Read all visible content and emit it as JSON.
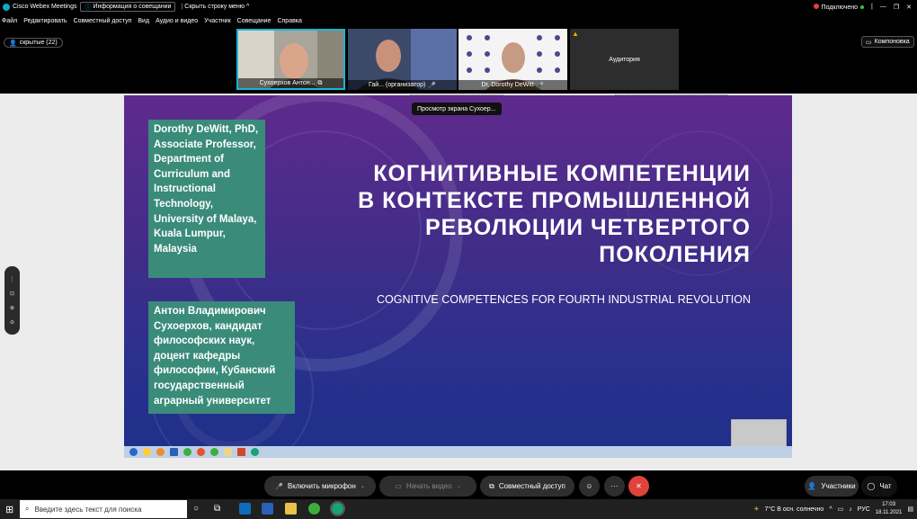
{
  "titlebar": {
    "app_name": "Cisco Webex Meetings",
    "info_button": "Информация о совещании",
    "hide_menu": "Скрыть строку меню",
    "status": "Подключено"
  },
  "menu": [
    "Файл",
    "Редактировать",
    "Совместный доступ",
    "Вид",
    "Аудио и видео",
    "Участник",
    "Совещание",
    "Справка"
  ],
  "strip": {
    "hidden_count_label": "скрытые (22)",
    "layout_label": "Компоновка",
    "tiles": [
      {
        "name": "Сухоерхов Антон..."
      },
      {
        "name": "Гай...  (организатор)"
      },
      {
        "name": "Dr. Dorothy DeWitt"
      },
      {
        "name": "Аудитория"
      }
    ]
  },
  "tooltip": "Просмотр экрана Сухоер...",
  "slide": {
    "author1": "Dorothy DeWitt, PhD, Associate Professor, Department of Curriculum and Instructional Technology, University of Malaya, Kuala Lumpur, Malaysia",
    "author2": "Антон Владимирович Сухоерхов, кандидат философских наук, доцент кафедры философии, Кубанский государственный аграрный университет",
    "title_lines": [
      "КОГНИТИВНЫЕ КОМПЕТЕНЦИИ",
      "В КОНТЕКСТЕ ПРОМЫШЛЕННОЙ",
      "РЕВОЛЮЦИИ ЧЕТВЕРТОГО",
      "ПОКОЛЕНИЯ"
    ],
    "subtitle": "COGNITIVE COMPETENCES FOR FOURTH INDUSTRIAL REVOLUTION"
  },
  "controls": {
    "mic": "Включить микрофон",
    "video": "Начать видео",
    "share": "Совместный доступ",
    "participants": "Участники",
    "chat": "Чат"
  },
  "taskbar": {
    "search_placeholder": "Введите здесь текст для поиска",
    "weather": "7°С  В осн. солнечно",
    "lang": "РУС",
    "time": "17:03",
    "date": "18.11.2021"
  },
  "colors": {
    "accent": "#19b5d8",
    "end_call": "#e0433b",
    "green_box": "#3a8b7a"
  }
}
